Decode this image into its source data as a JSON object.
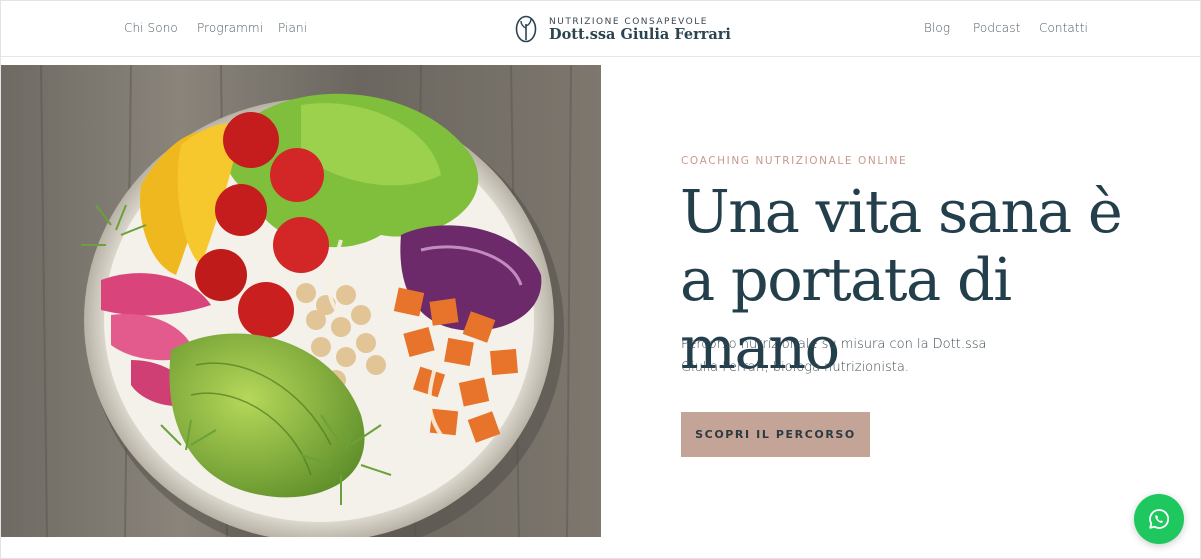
{
  "nav": {
    "left": [
      {
        "label": "Chi Sono"
      },
      {
        "label": "Programmi"
      },
      {
        "label": "Piani"
      }
    ],
    "right": [
      {
        "label": "Blog"
      },
      {
        "label": "Podcast"
      },
      {
        "label": "Contatti"
      }
    ]
  },
  "logo": {
    "kicker": "NUTRIZIONE CONSAPEVOLE",
    "name": "Dott.ssa Giulia Ferrari",
    "icon": "sprout-icon"
  },
  "hero": {
    "eyebrow": "COACHING NUTRIZIONALE ONLINE",
    "headline": "Una vita sana è a portata di mano",
    "description": "Percorso nutrizionale su misura con la Dott.ssa Giulia Ferrari, biologa nutrizionista.",
    "cta_label": "SCOPRI IL PERCORSO",
    "image_subject": "salad bowl"
  },
  "floating": {
    "whatsapp_icon": "whatsapp-icon"
  },
  "colors": {
    "accent": "#c4a497",
    "eyebrow": "#c69a8a",
    "heading": "#243f4c",
    "whatsapp": "#1ec85e"
  }
}
